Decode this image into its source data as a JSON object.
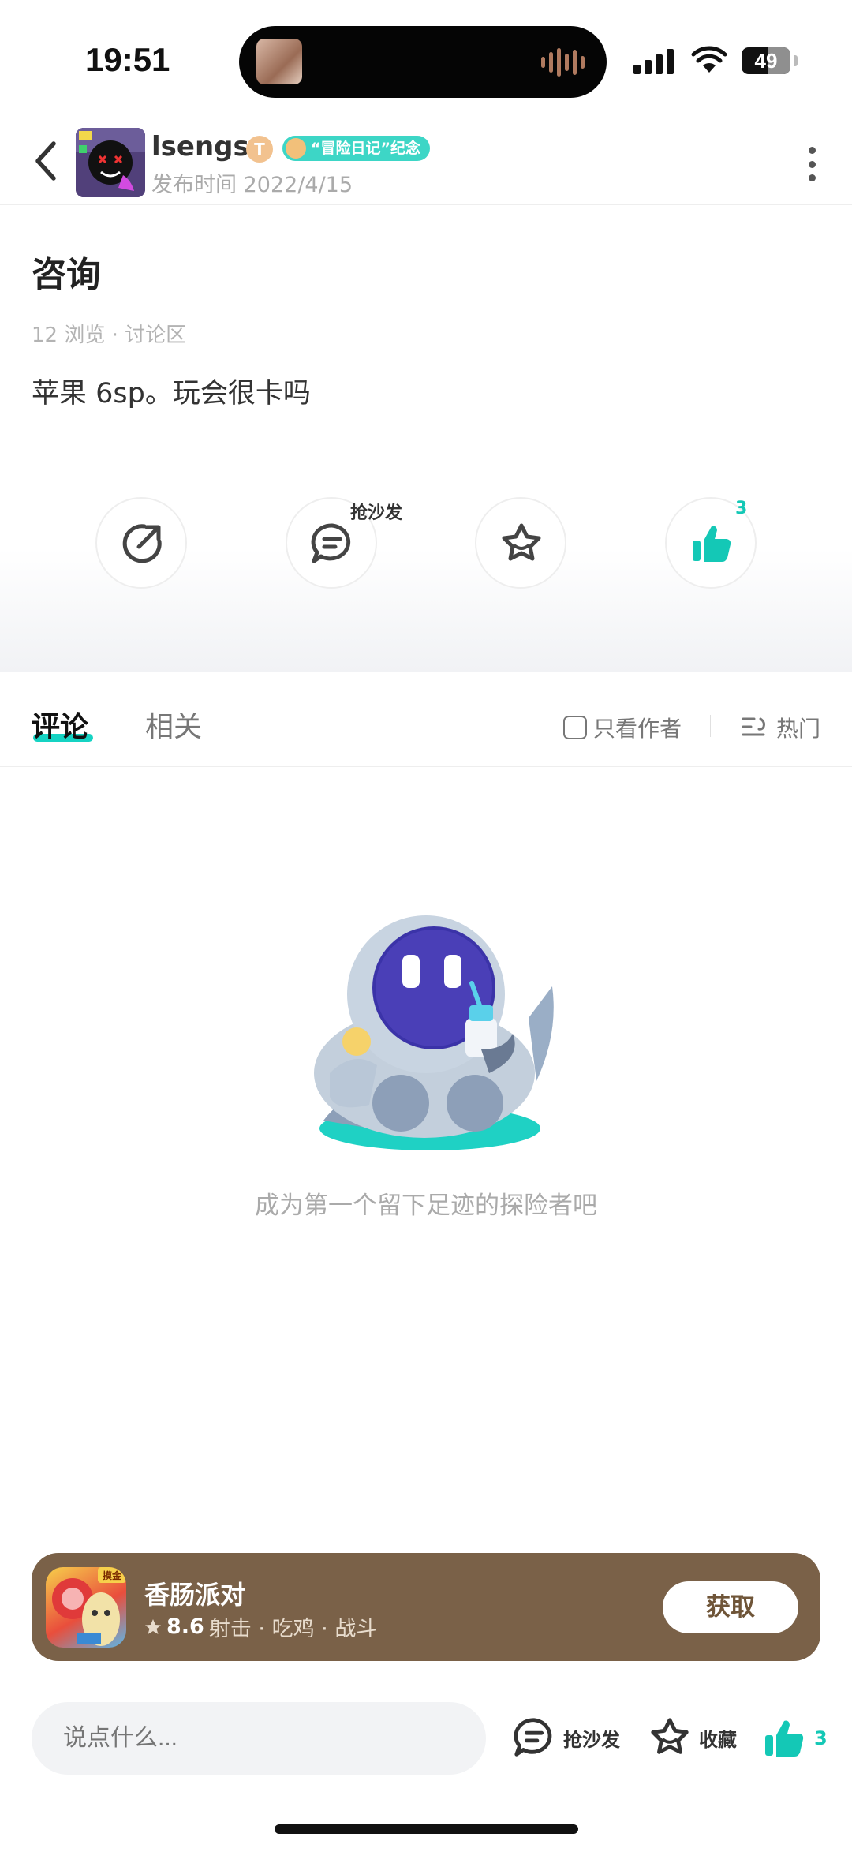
{
  "status_bar": {
    "time": "19:51",
    "battery": "49"
  },
  "header": {
    "author_name": "lsengs",
    "level_badge": "T",
    "badge_text": "“冒险日记”纪念",
    "publish_time": "发布时间 2022/4/15"
  },
  "post": {
    "title": "咨询",
    "meta": "12 浏览 · 讨论区",
    "body": "苹果 6sp。玩会很卡吗"
  },
  "actions": {
    "comment_badge": "抢沙发",
    "like_count": "3"
  },
  "tabs": {
    "comments": "评论",
    "related": "相关",
    "only_author": "只看作者",
    "sort": "热门"
  },
  "empty_state": {
    "text": "成为第一个留下足迹的探险者吧"
  },
  "game_card": {
    "name": "香肠派对",
    "score": "8.6",
    "tags": "射击 · 吃鸡 · 战斗",
    "icon_tag": "摸金",
    "button": "获取",
    "colors": {
      "card_bg": "#7a6148"
    }
  },
  "bottom_bar": {
    "placeholder": "说点什么...",
    "sofa_label": "抢沙发",
    "favorite_label": "收藏",
    "like_count": "3"
  },
  "colors": {
    "accent": "#14c8b6"
  }
}
